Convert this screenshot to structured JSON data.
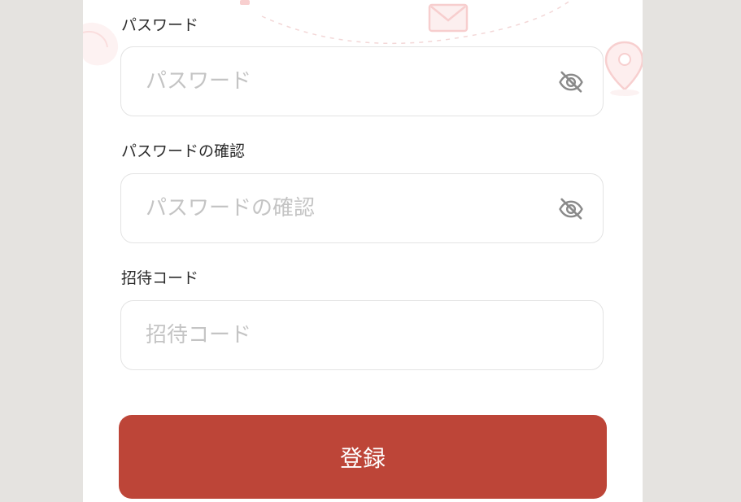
{
  "form": {
    "password": {
      "label": "パスワード",
      "placeholder": "パスワード",
      "value": ""
    },
    "confirm_password": {
      "label": "パスワードの確認",
      "placeholder": "パスワードの確認",
      "value": ""
    },
    "invite_code": {
      "label": "招待コード",
      "placeholder": "招待コード",
      "value": ""
    },
    "submit_label": "登録"
  },
  "icons": {
    "password_toggle": "eye-off-icon",
    "confirm_toggle": "eye-off-icon",
    "decor_mail": "mail-icon",
    "decor_pin": "map-pin-icon"
  },
  "colors": {
    "accent": "#bd4538",
    "background": "#e5e3e0",
    "panel": "#ffffff",
    "placeholder": "#c4c4c4",
    "decor": "#f5c6c6"
  }
}
